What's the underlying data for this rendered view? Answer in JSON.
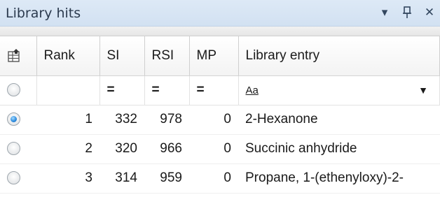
{
  "panel": {
    "title": "Library hits",
    "controls": {
      "dropdown_glyph": "▾",
      "pin_glyph": "ᵼ",
      "close_glyph": "✕"
    }
  },
  "columns": {
    "rank": "Rank",
    "si": "SI",
    "rsi": "RSI",
    "mp": "MP",
    "entry": "Library entry"
  },
  "filter_row": {
    "si": "=",
    "rsi": "=",
    "mp": "=",
    "entry_mode": "Aa",
    "entry_dropdown_glyph": "▼"
  },
  "rows": [
    {
      "selected": true,
      "rank": "1",
      "si": "332",
      "rsi": "978",
      "mp": "0",
      "entry": "2-Hexanone"
    },
    {
      "selected": false,
      "rank": "2",
      "si": "320",
      "rsi": "966",
      "mp": "0",
      "entry": "Succinic anhydride"
    },
    {
      "selected": false,
      "rank": "3",
      "si": "314",
      "rsi": "959",
      "mp": "0",
      "entry": "Propane, 1-(ethenyloxy)-2-"
    }
  ],
  "icons": [
    "column-chooser-icon",
    "radio-icon",
    "dropdown-arrow-icon",
    "pin-icon",
    "close-icon"
  ],
  "colors": {
    "titlebar": "#d9e6f4",
    "radio_selected": "#2f8ee0"
  }
}
